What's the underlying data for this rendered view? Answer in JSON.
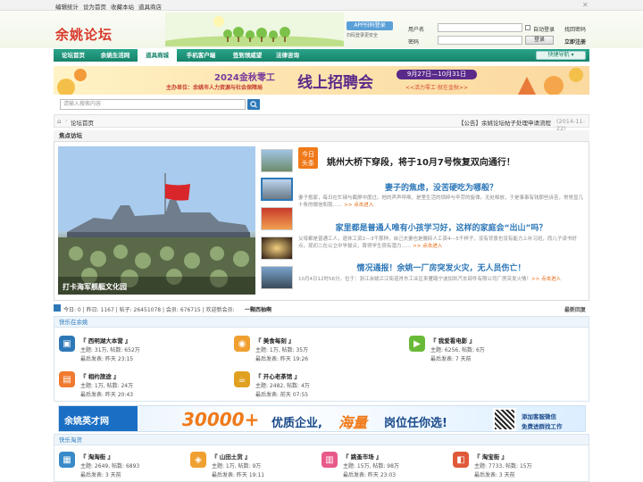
{
  "topbar": {
    "links": [
      "编辑统计",
      "设为首页",
      "收藏本站",
      "道具商店"
    ],
    "close": "✕"
  },
  "header": {
    "logo": "余姚论坛",
    "app_button": "APP扫码登录",
    "app_sub": "扫码登录更安全",
    "username_label": "用户名",
    "password_label": "密码",
    "auto_login": "自动登录",
    "forgot": "找回密码",
    "login": "登录",
    "register": "立即注册"
  },
  "nav": {
    "items": [
      "论坛首页",
      "余姚生活网",
      "道具商城",
      "手机客户端",
      "签到领威望",
      "法律咨询"
    ],
    "quick": "快捷导航"
  },
  "banner": {
    "year_line": "2024金秋零工",
    "main": "线上招聘会",
    "sponsor": "主办单位：余姚市人力资源与社会保障局",
    "dates": "9月27日—10月31日",
    "slogan": "<<活力零工·就在金秋>>"
  },
  "search": {
    "placeholder": "请输入搜索内容"
  },
  "breadcrumb": {
    "home": "论坛首页",
    "notice": "【公告】余姚论坛帖子处理申请流程",
    "notice_date": "(2014-11-22)"
  },
  "focus": {
    "title": "焦点访坛",
    "slide_caption": "打卡海军舰艇文化园",
    "badge_top": "今日",
    "badge_bottom": "头条",
    "headline1": "姚州大桥下穿段，将于10月7号恢复双向通行！",
    "items": [
      {
        "title": "妻子的焦虑，没苦硬吃为哪般？",
        "desc": "妻子抱家，每日在忙碌与截屏中度过。他的声声呼唤，是里生活的琐碎与辛劳的旋律。无处释放，于是事事有钱那些诉苦，常常显几十条的微信和我…… ",
        "more": ">> 点击进入"
      },
      {
        "title": "家里都是普通人唯有小孩学习好，这样的家庭会“出山”吗？",
        "desc": "父母都是普通工人，退休工资2---3千那种，自己夫妻也是搬砖人工资4---5千样子，没有背景也没有能力上补习班，而儿子读书好点，现初二在公立中学拔尖，算得学生很有潜力…… ",
        "more": ">> 点击进入"
      },
      {
        "title": "情况通报！余姚一厂房突发火灾，无人员伤亡！",
        "desc": "10月4日12时56分，位于：浙江余姚兰江街道肖东工业区来雁路宁波加凯汽车部件有限公司厂房突发火情！",
        "more": ">> 点击进入"
      }
    ]
  },
  "stats": {
    "text": "今日: 0 | 昨日: 1167 | 帖子: 26451078 | 会员: 676715 | 欢迎新会员:",
    "new_member": "一颗西柚啊",
    "latest": "最新回复"
  },
  "section1": {
    "title": "快乐在余姚",
    "forums": [
      {
        "name": "『 西明湖大本营 』",
        "stat": "主题: 31万, 帖数: 652万",
        "last": "最后发表: 昨天 23:15",
        "color": "#2e78b8",
        "icon": "book-icon",
        "glyph": "▣"
      },
      {
        "name": "『 美食每刻 』",
        "stat": "主题: 1万, 帖数: 35万",
        "last": "最后发表: 昨天 19:26",
        "color": "#f0a030",
        "icon": "food-icon",
        "glyph": "◉"
      },
      {
        "name": "『 我爱看电影 』",
        "stat": "主题: 6256, 帖数: 6万",
        "last": "最后发表: 7 天前",
        "color": "#6aba3a",
        "icon": "film-icon",
        "glyph": "▶"
      },
      {
        "name": "『 相约旅途 』",
        "stat": "主题: 1万, 帖数: 24万",
        "last": "最后发表: 昨天 20:43",
        "color": "#f07a30",
        "icon": "luggage-icon",
        "glyph": "▤"
      },
      {
        "name": "『 开心老茶馆 』",
        "stat": "主题: 2482, 帖数: 4万",
        "last": "最后发表: 前天 07:55",
        "color": "#e0a020",
        "icon": "teapot-icon",
        "glyph": "☕"
      }
    ]
  },
  "ad2": {
    "brand": "余姚英才网",
    "number": "30000+",
    "text1": "优质企业,",
    "text2": "海量",
    "text3": "岗位任你选!",
    "right1": "添加客服微信",
    "right2": "免费进群找工作"
  },
  "section2": {
    "title": "快乐淘货",
    "forums": [
      {
        "name": "『 淘淘街 』",
        "stat": "主题: 2649, 帖数: 6893",
        "last": "最后发表: 3 天前",
        "color": "#3a8ac8",
        "icon": "shop-icon",
        "glyph": "▦"
      },
      {
        "name": "『 山田土货 』",
        "stat": "主题: 1万, 帖数: 9万",
        "last": "最后发表: 昨天 19:11",
        "color": "#f0a030",
        "icon": "bag-icon",
        "glyph": "◈"
      },
      {
        "name": "『 跳蚤市场 』",
        "stat": "主题: 15万, 帖数: 98万",
        "last": "最后发表: 昨天 23:03",
        "color": "#e85a8a",
        "icon": "market-icon",
        "glyph": "▥"
      },
      {
        "name": "『 淘宝街 』",
        "stat": "主题: 7733, 帖数: 15万",
        "last": "最后发表: 3 天前",
        "color": "#e05a3a",
        "icon": "taobao-icon",
        "glyph": "◧"
      }
    ]
  }
}
